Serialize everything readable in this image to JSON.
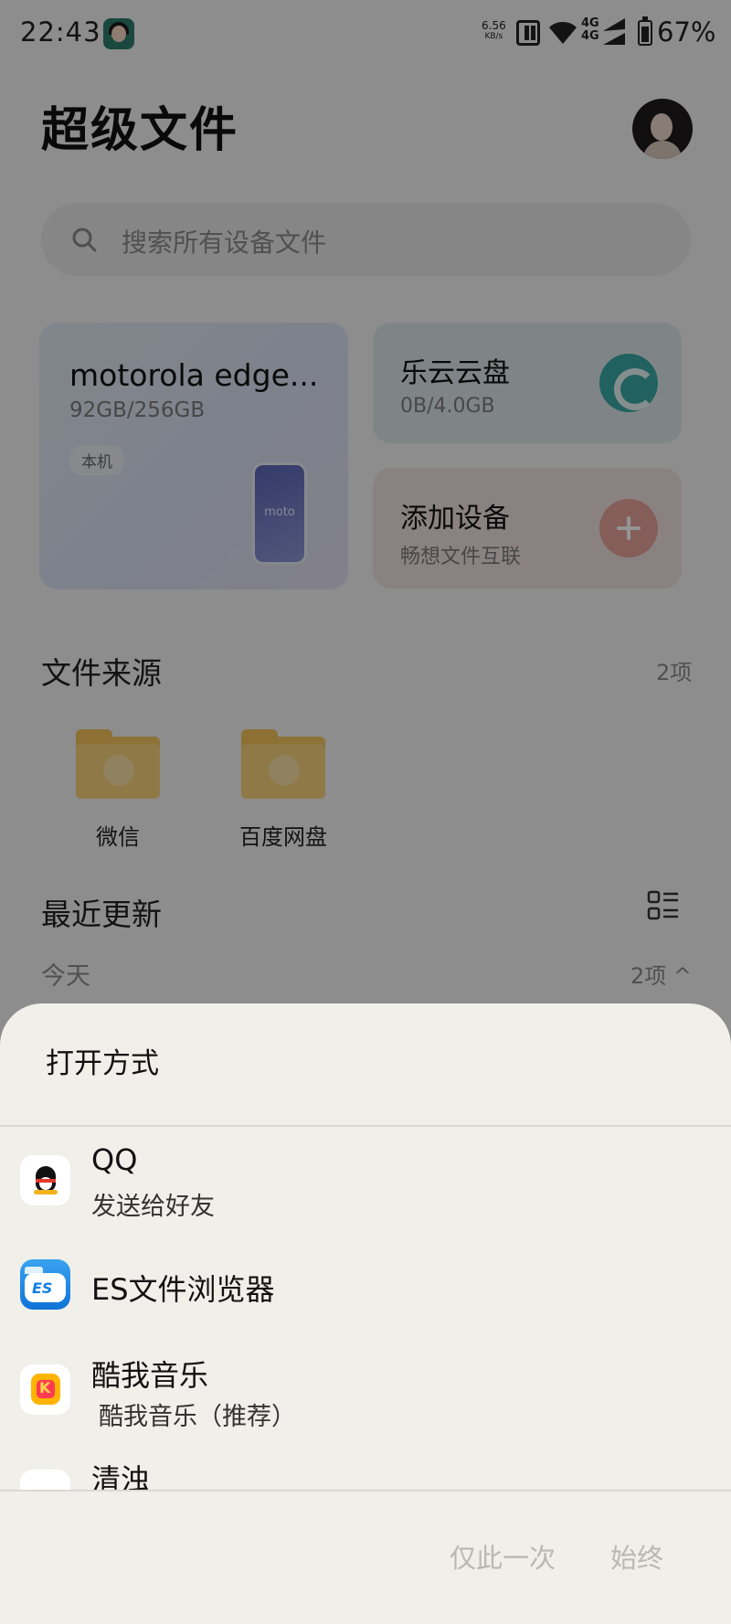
{
  "status_bar": {
    "time": "22:43",
    "net_speed": "6.56",
    "net_unit": "KB/s",
    "signal_label": "4G",
    "battery": "67%"
  },
  "app": {
    "title": "超级文件",
    "search_placeholder": "搜索所有设备文件",
    "device_card": {
      "name": "motorola edge...",
      "storage": "92GB/256GB",
      "badge": "本机",
      "phone_brand": "moto"
    },
    "cloud_card": {
      "title": "乐云云盘",
      "storage": "0B/4.0GB"
    },
    "add_card": {
      "title": "添加设备",
      "subtitle": "畅想文件互联"
    },
    "sources": {
      "title": "文件来源",
      "count": "2项",
      "items": [
        {
          "label": "微信",
          "icon": "wechat-icon"
        },
        {
          "label": "百度网盘",
          "icon": "baidu-netdisk-icon"
        }
      ]
    },
    "recent": {
      "title": "最近更新",
      "group": "今天",
      "group_count": "2项 ^"
    }
  },
  "sheet": {
    "title": "打开方式",
    "apps": [
      {
        "name": "QQ",
        "sub": "发送给好友",
        "icon": "qq-icon"
      },
      {
        "name": "ES文件浏览器",
        "icon": "es-file-explorer-icon"
      },
      {
        "name": "酷我音乐",
        "sub": "酷我音乐（推荐）",
        "icon": "kuwo-music-icon"
      },
      {
        "name": "清浊",
        "icon": "qingzhuo-icon"
      }
    ],
    "once_label": "仅此一次",
    "always_label": "始终"
  }
}
